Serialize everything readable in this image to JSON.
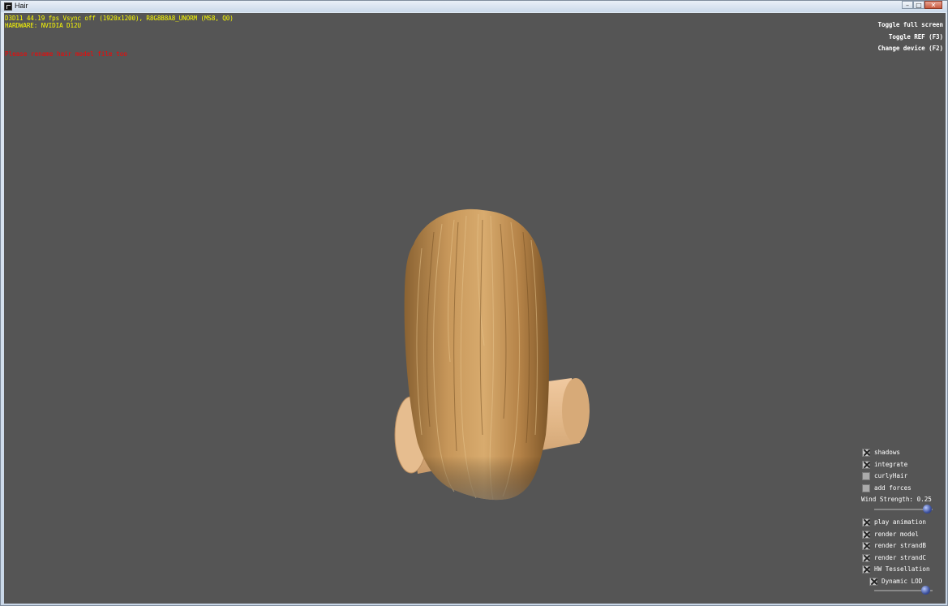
{
  "window": {
    "title": "Hair",
    "buttons": [
      "minimize",
      "maximize",
      "close"
    ]
  },
  "stats": {
    "line1": "D3D11 44.19 fps Vsync off (1920x1200), R8G8B8A8_UNORM (MS8, Q0)",
    "line2": "HARDWARE: NVIDIA D12U"
  },
  "warning": "Please rename hair model file too",
  "top_buttons": [
    "Toggle full screen",
    "Toggle REF (F3)",
    "Change device (F2)"
  ],
  "controls": {
    "shadows": {
      "label": "shadows",
      "checked": true
    },
    "integrate": {
      "label": "integrate",
      "checked": true
    },
    "curly_hair": {
      "label": "curlyHair",
      "checked": false
    },
    "add_forces": {
      "label": "add forces",
      "checked": false
    },
    "wind_strength": {
      "label": "Wind Strength: 0.25",
      "value": 0.25
    },
    "play_animation": {
      "label": "play animation",
      "checked": true
    },
    "render_model": {
      "label": "render model",
      "checked": true
    },
    "render_strand_b": {
      "label": "render strandB",
      "checked": true
    },
    "render_strand_c": {
      "label": "render strandC",
      "checked": true
    },
    "hw_tessellation": {
      "label": "HW Tessellation",
      "checked": true
    },
    "dynamic_lod": {
      "label": "Dynamic LOD",
      "checked": true
    },
    "lod_slider": {
      "value": 0.9
    }
  },
  "colors": {
    "background": "#555555",
    "stats_text": "#ffff00",
    "warning_text": "#ff0000",
    "hair": "#b8874e",
    "cylinder": "#e2b98c"
  }
}
